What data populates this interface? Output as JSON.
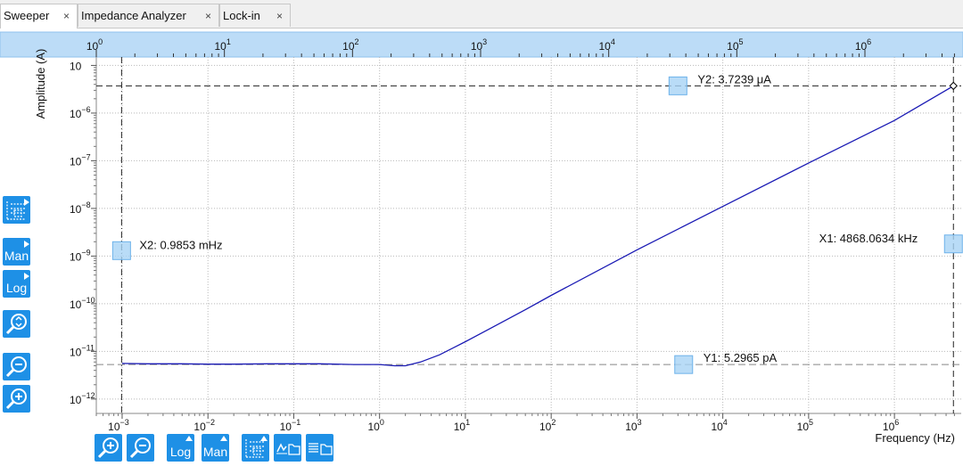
{
  "tabs": [
    {
      "label": "Sweeper",
      "close": "×",
      "active": true
    },
    {
      "label": "Impedance Analyzer",
      "close": "×",
      "active": false
    },
    {
      "label": "Lock-in",
      "close": "×",
      "active": false
    }
  ],
  "toolbar": {
    "man_label": "Man",
    "log_label": "Log",
    "bottom_log_label": "Log",
    "bottom_man_label": "Man"
  },
  "colors": {
    "accent": "#1e90e6",
    "trace": "#1a1ab4",
    "top_axis_band": "#bcdcf7"
  },
  "cursors": {
    "x1": {
      "label": "X1: 4868.0634 kHz",
      "value_hz": 4868063.4
    },
    "x2": {
      "label": "X2: 0.9853 mHz",
      "value_hz": 0.0009853
    },
    "y1": {
      "label": "Y1: 5.2965 pA",
      "value_a": 5.2965e-12
    },
    "y2": {
      "label": "Y2: 3.7239 μA",
      "value_a": 3.7239e-06
    }
  },
  "chart_data": {
    "type": "line",
    "xlabel": "Frequency (Hz)",
    "ylabel": "Amplitude (A)",
    "xscale": "log",
    "yscale": "log",
    "xlim": [
      0.0005,
      6000000
    ],
    "ylim": [
      5e-13,
      1.5e-05
    ],
    "top_axis_ticks": [
      {
        "value": 1,
        "base": "10",
        "exp": "0"
      },
      {
        "value": 10,
        "base": "10",
        "exp": "1"
      },
      {
        "value": 100,
        "base": "10",
        "exp": "2"
      },
      {
        "value": 1000,
        "base": "10",
        "exp": "3"
      },
      {
        "value": 10000,
        "base": "10",
        "exp": "4"
      },
      {
        "value": 100000,
        "base": "10",
        "exp": "5"
      },
      {
        "value": 1000000,
        "base": "10",
        "exp": "6"
      }
    ],
    "x_ticks": [
      {
        "value": 0.001,
        "base": "10",
        "exp": "−3"
      },
      {
        "value": 0.01,
        "base": "10",
        "exp": "−2"
      },
      {
        "value": 0.1,
        "base": "10",
        "exp": "−1"
      },
      {
        "value": 1,
        "base": "10",
        "exp": "0"
      },
      {
        "value": 10,
        "base": "10",
        "exp": "1"
      },
      {
        "value": 100,
        "base": "10",
        "exp": "2"
      },
      {
        "value": 1000,
        "base": "10",
        "exp": "3"
      },
      {
        "value": 10000,
        "base": "10",
        "exp": "4"
      },
      {
        "value": 100000,
        "base": "10",
        "exp": "5"
      },
      {
        "value": 1000000,
        "base": "10",
        "exp": "6"
      }
    ],
    "y_ticks": [
      {
        "value": 1e-05,
        "base": "10",
        "exp": ""
      },
      {
        "value": 1e-06,
        "base": "10",
        "exp": "−6"
      },
      {
        "value": 1e-07,
        "base": "10",
        "exp": "−7"
      },
      {
        "value": 1e-08,
        "base": "10",
        "exp": "−8"
      },
      {
        "value": 1e-09,
        "base": "10",
        "exp": "−9"
      },
      {
        "value": 1e-10,
        "base": "10",
        "exp": "−10"
      },
      {
        "value": 1e-11,
        "base": "10",
        "exp": "−11"
      },
      {
        "value": 1e-12,
        "base": "10",
        "exp": "−12"
      }
    ],
    "grid": true,
    "series": [
      {
        "x": [
          0.001,
          0.002,
          0.005,
          0.01,
          0.02,
          0.05,
          0.1,
          0.2,
          0.5,
          1,
          1.5,
          2,
          3,
          5,
          10,
          20,
          50,
          100,
          1000,
          10000,
          100000,
          1000000,
          4868063
        ],
        "y": [
          5.6e-12,
          5.5e-12,
          5.5e-12,
          5.4e-12,
          5.4e-12,
          5.5e-12,
          5.5e-12,
          5.5e-12,
          5.3e-12,
          5.3e-12,
          5e-12,
          5e-12,
          6e-12,
          8.5e-12,
          1.6e-11,
          3.1e-11,
          7.5e-11,
          1.5e-10,
          1.35e-09,
          1.1e-08,
          9e-08,
          7e-07,
          3.7239e-06
        ]
      }
    ]
  }
}
